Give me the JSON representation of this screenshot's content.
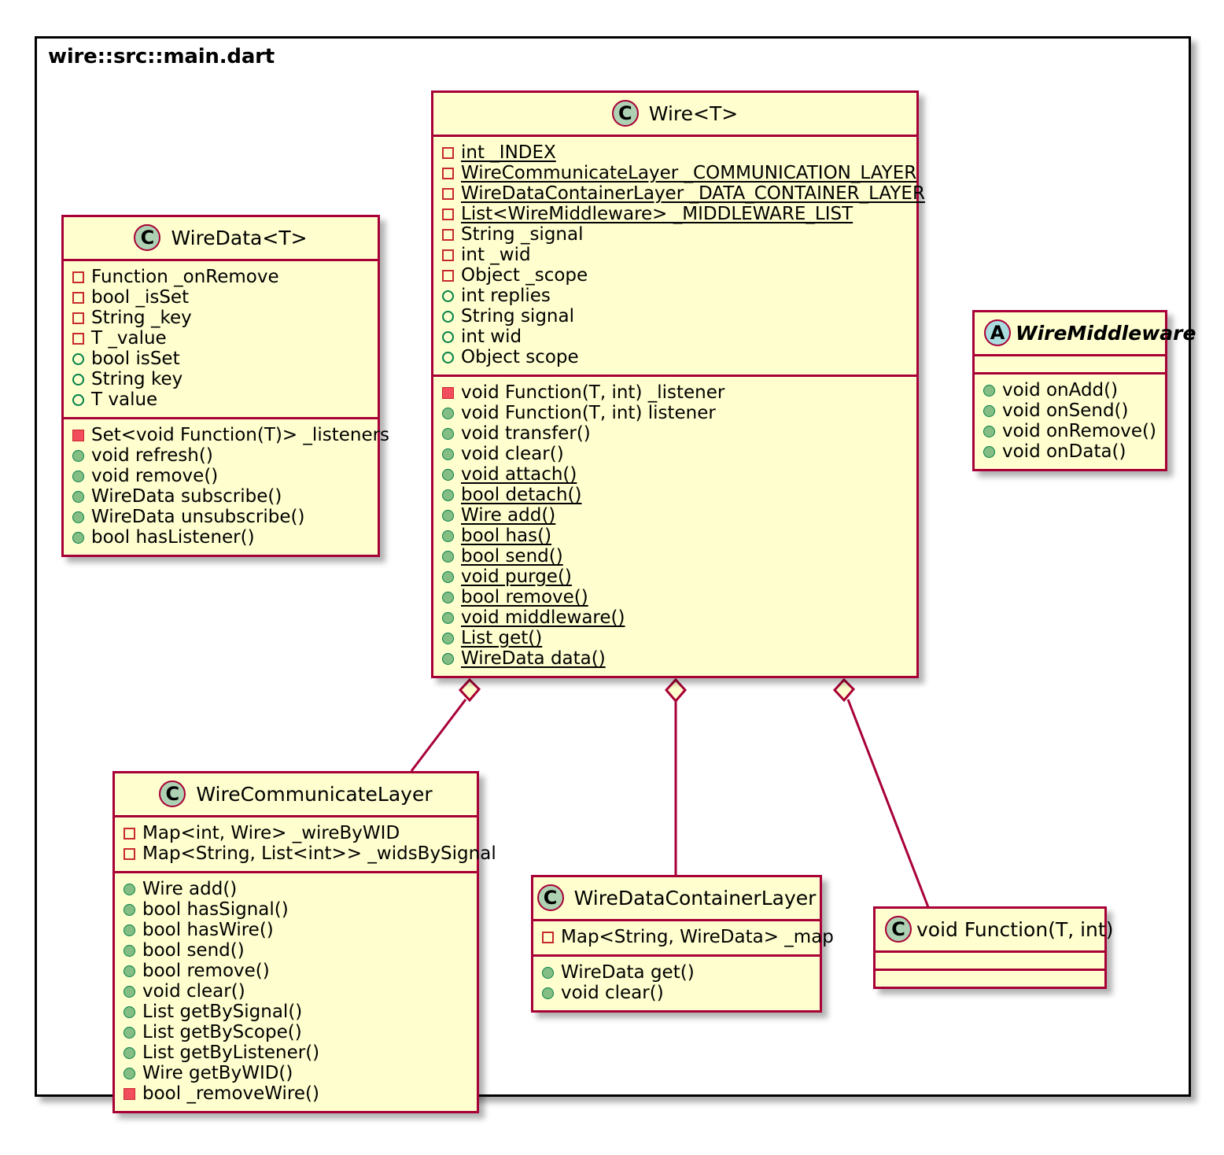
{
  "package": {
    "label": "wire::src::main.dart"
  },
  "classes": {
    "wire": {
      "name": "Wire<T>",
      "stereotype_icon": "class-icon-C",
      "attributes": [
        {
          "text": "int _INDEX",
          "visibility": "private",
          "static": true
        },
        {
          "text": "WireCommunicateLayer _COMMUNICATION_LAYER",
          "visibility": "private",
          "static": true
        },
        {
          "text": "WireDataContainerLayer _DATA_CONTAINER_LAYER",
          "visibility": "private",
          "static": true
        },
        {
          "text": "List<WireMiddleware> _MIDDLEWARE_LIST",
          "visibility": "private",
          "static": true
        },
        {
          "text": "String _signal",
          "visibility": "private",
          "static": false
        },
        {
          "text": "int _wid",
          "visibility": "private",
          "static": false
        },
        {
          "text": "Object _scope",
          "visibility": "private",
          "static": false
        },
        {
          "text": "int replies",
          "visibility": "public",
          "static": false
        },
        {
          "text": "String signal",
          "visibility": "public",
          "static": false
        },
        {
          "text": "int wid",
          "visibility": "public",
          "static": false
        },
        {
          "text": "Object scope",
          "visibility": "public",
          "static": false
        }
      ],
      "methods": [
        {
          "text": "void Function(T, int) _listener",
          "visibility": "private",
          "static": false
        },
        {
          "text": "void Function(T, int) listener",
          "visibility": "public",
          "static": false
        },
        {
          "text": "void transfer()",
          "visibility": "public",
          "static": false
        },
        {
          "text": "void clear()",
          "visibility": "public",
          "static": false
        },
        {
          "text": "void attach()",
          "visibility": "public",
          "static": true
        },
        {
          "text": "bool detach()",
          "visibility": "public",
          "static": true
        },
        {
          "text": "Wire add()",
          "visibility": "public",
          "static": true
        },
        {
          "text": "bool has()",
          "visibility": "public",
          "static": true
        },
        {
          "text": "bool send()",
          "visibility": "public",
          "static": true
        },
        {
          "text": "void purge()",
          "visibility": "public",
          "static": true
        },
        {
          "text": "bool remove()",
          "visibility": "public",
          "static": true
        },
        {
          "text": "void middleware()",
          "visibility": "public",
          "static": true
        },
        {
          "text": "List get()",
          "visibility": "public",
          "static": true
        },
        {
          "text": "WireData data()",
          "visibility": "public",
          "static": true
        }
      ]
    },
    "wireData": {
      "name": "WireData<T>",
      "stereotype_icon": "class-icon-C",
      "attributes": [
        {
          "text": "Function _onRemove",
          "visibility": "private",
          "static": false
        },
        {
          "text": "bool _isSet",
          "visibility": "private",
          "static": false
        },
        {
          "text": "String _key",
          "visibility": "private",
          "static": false
        },
        {
          "text": "T _value",
          "visibility": "private",
          "static": false
        },
        {
          "text": "bool isSet",
          "visibility": "public",
          "static": false
        },
        {
          "text": "String key",
          "visibility": "public",
          "static": false
        },
        {
          "text": "T value",
          "visibility": "public",
          "static": false
        }
      ],
      "methods": [
        {
          "text": "Set<void Function(T)> _listeners",
          "visibility": "private",
          "static": false
        },
        {
          "text": "void refresh()",
          "visibility": "public",
          "static": false
        },
        {
          "text": "void remove()",
          "visibility": "public",
          "static": false
        },
        {
          "text": "WireData subscribe()",
          "visibility": "public",
          "static": false
        },
        {
          "text": "WireData unsubscribe()",
          "visibility": "public",
          "static": false
        },
        {
          "text": "bool hasListener()",
          "visibility": "public",
          "static": false
        }
      ]
    },
    "wireMiddleware": {
      "name": "WireMiddleware",
      "stereotype_icon": "class-icon-A",
      "abstract": true,
      "attributes": [],
      "methods": [
        {
          "text": "void onAdd()",
          "visibility": "public",
          "static": false
        },
        {
          "text": "void onSend()",
          "visibility": "public",
          "static": false
        },
        {
          "text": "void onRemove()",
          "visibility": "public",
          "static": false
        },
        {
          "text": "void onData()",
          "visibility": "public",
          "static": false
        }
      ]
    },
    "wireCommunicateLayer": {
      "name": "WireCommunicateLayer",
      "stereotype_icon": "class-icon-C",
      "attributes": [
        {
          "text": "Map<int, Wire> _wireByWID",
          "visibility": "private",
          "static": false
        },
        {
          "text": "Map<String, List<int>> _widsBySignal",
          "visibility": "private",
          "static": false
        }
      ],
      "methods": [
        {
          "text": "Wire add()",
          "visibility": "public",
          "static": false
        },
        {
          "text": "bool hasSignal()",
          "visibility": "public",
          "static": false
        },
        {
          "text": "bool hasWire()",
          "visibility": "public",
          "static": false
        },
        {
          "text": "bool send()",
          "visibility": "public",
          "static": false
        },
        {
          "text": "bool remove()",
          "visibility": "public",
          "static": false
        },
        {
          "text": "void clear()",
          "visibility": "public",
          "static": false
        },
        {
          "text": "List getBySignal()",
          "visibility": "public",
          "static": false
        },
        {
          "text": "List getByScope()",
          "visibility": "public",
          "static": false
        },
        {
          "text": "List getByListener()",
          "visibility": "public",
          "static": false
        },
        {
          "text": "Wire getByWID()",
          "visibility": "public",
          "static": false
        },
        {
          "text": "bool _removeWire()",
          "visibility": "private",
          "static": false
        }
      ]
    },
    "wireDataContainerLayer": {
      "name": "WireDataContainerLayer",
      "stereotype_icon": "class-icon-C",
      "attributes": [
        {
          "text": "Map<String, WireData> _map",
          "visibility": "private",
          "static": false
        }
      ],
      "methods": [
        {
          "text": "WireData get()",
          "visibility": "public",
          "static": false
        },
        {
          "text": "void clear()",
          "visibility": "public",
          "static": false
        }
      ]
    },
    "voidFunction": {
      "name": "void Function(T, int)",
      "stereotype_icon": "class-icon-C",
      "attributes": [],
      "methods": []
    }
  },
  "relations": [
    {
      "from": "Wire<T>",
      "to": "WireCommunicateLayer",
      "type": "aggregation"
    },
    {
      "from": "Wire<T>",
      "to": "WireDataContainerLayer",
      "type": "aggregation"
    },
    {
      "from": "Wire<T>",
      "to": "void Function(T, int)",
      "type": "aggregation"
    }
  ],
  "colors": {
    "class_fill": "#FEFECE",
    "class_border": "#A80036",
    "class_icon_fill": "#ADD1B2",
    "abstract_icon_fill": "#A9DCDF",
    "public_marker": "#84BE84",
    "private_marker": "#F24D5C",
    "frame_border": "#000000"
  }
}
